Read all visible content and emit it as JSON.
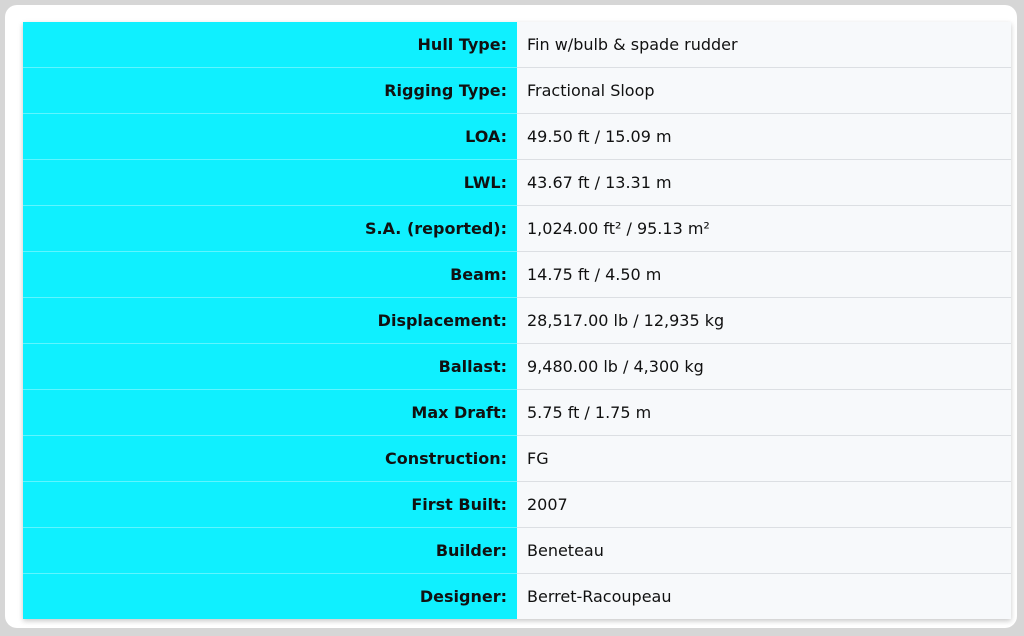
{
  "specs": [
    {
      "label": "Hull Type:",
      "value": "Fin w/bulb & spade rudder"
    },
    {
      "label": "Rigging Type:",
      "value": "Fractional Sloop"
    },
    {
      "label": "LOA:",
      "value": "49.50 ft / 15.09 m"
    },
    {
      "label": "LWL:",
      "value": "43.67 ft / 13.31 m"
    },
    {
      "label": "S.A. (reported):",
      "value": "1,024.00 ft² / 95.13 m²"
    },
    {
      "label": "Beam:",
      "value": "14.75 ft / 4.50 m"
    },
    {
      "label": "Displacement:",
      "value": "28,517.00 lb / 12,935 kg"
    },
    {
      "label": "Ballast:",
      "value": "9,480.00 lb / 4,300 kg"
    },
    {
      "label": "Max Draft:",
      "value": "5.75 ft / 1.75 m"
    },
    {
      "label": "Construction:",
      "value": "FG"
    },
    {
      "label": "First Built:",
      "value": "2007"
    },
    {
      "label": "Builder:",
      "value": "Beneteau"
    },
    {
      "label": "Designer:",
      "value": "Berret-Racoupeau"
    }
  ],
  "colors": {
    "label_background": "#0ff0ff",
    "value_background": "#f7f9fb"
  }
}
